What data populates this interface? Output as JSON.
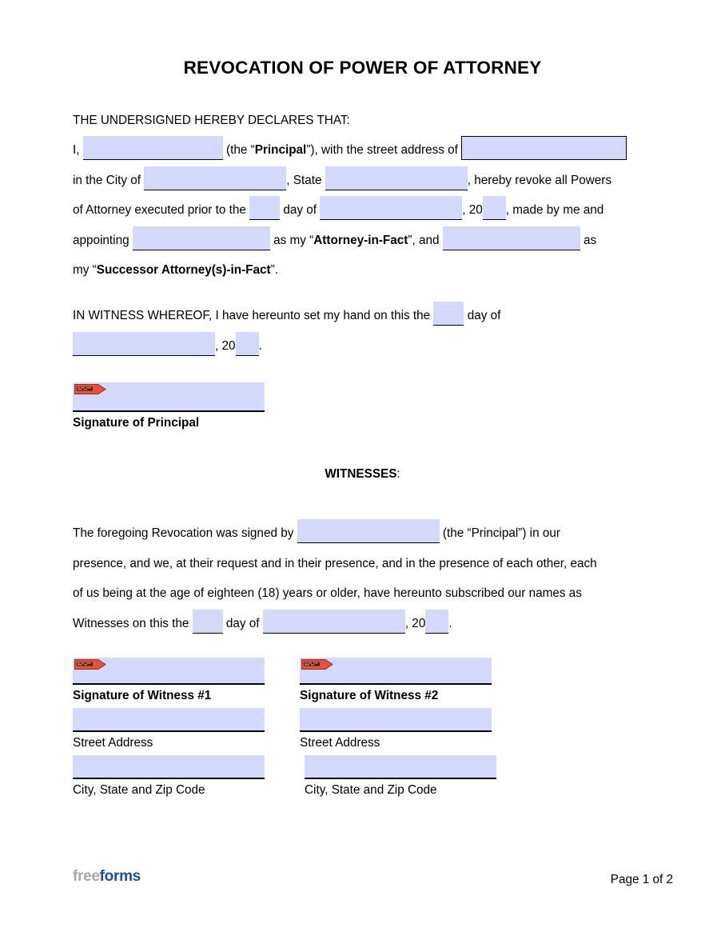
{
  "document": {
    "title": "REVOCATION OF POWER OF ATTORNEY",
    "intro_heading": "THE UNDERSIGNED HEREBY DECLARES THAT:"
  },
  "declaration": {
    "l1_a": "I,",
    "l1_b": "(the “",
    "l1_principal": "Principal",
    "l1_c": "”), with the street address of",
    "l2_a": "in the City of",
    "l2_b": ", State",
    "l2_c": ", hereby revoke all Powers",
    "l3_a": "of Attorney executed prior to the",
    "l3_b": "day of",
    "l3_c": ", 20",
    "l3_d": ", made by me and",
    "l4_a": "appointing",
    "l4_b": "as my “",
    "l4_attorney": "Attorney-in-Fact",
    "l4_c": "”, and",
    "l4_d": "as",
    "l5_a": "my “",
    "l5_successor": "Successor Attorney(s)-in-Fact",
    "l5_b": "”."
  },
  "witness_whereof": {
    "l1_a": "IN WITNESS WHEREOF, I have hereunto set my hand on this the",
    "l1_b": "day of",
    "l2_a": ", 20",
    "l2_b": "."
  },
  "principal_signature": {
    "label": "Signature of Principal",
    "tag": "sign-here-tag"
  },
  "witnesses": {
    "heading": "WITNESSES",
    "heading_colon": ":",
    "p_l1_a": "The foregoing Revocation was signed by",
    "p_l1_b": "(the “Principal”) in our",
    "p_l2": "presence, and we, at their request and in their presence, and in the presence of each other, each",
    "p_l3": "of us being at the age of eighteen (18) years or older, have hereunto subscribed our names as",
    "p_l4_a": "Witnesses on this the",
    "p_l4_b": "day of",
    "p_l4_c": ", 20",
    "p_l4_d": ".",
    "blocks": [
      {
        "signature_label": "Signature of Witness #1",
        "street_label": "Street Address",
        "city_label": "City, State and Zip Code"
      },
      {
        "signature_label": "Signature of Witness #2",
        "street_label": "Street Address",
        "city_label": "City, State and Zip Code"
      }
    ]
  },
  "footer": {
    "logo_free": "free",
    "logo_forms": "forms",
    "page_label": "Page 1 of 2"
  },
  "fields": {
    "principal_name": "",
    "street_address": "",
    "city": "",
    "state": "",
    "prior_day": "",
    "prior_month": "",
    "prior_year": "",
    "attorney_in_fact": "",
    "successor_attorney": "",
    "hand_day": "",
    "hand_month": "",
    "hand_year": "",
    "principal_signature": "",
    "witness_principal_name": "",
    "witness_day": "",
    "witness_month": "",
    "witness_year": "",
    "w1_signature": "",
    "w1_street": "",
    "w1_city": "",
    "w2_signature": "",
    "w2_street": "",
    "w2_city": ""
  },
  "colors": {
    "field_fill": "#d4d9fc",
    "tag": "#e2533f",
    "logo_free": "#a7a9ac",
    "logo_forms": "#1c4f9c"
  }
}
